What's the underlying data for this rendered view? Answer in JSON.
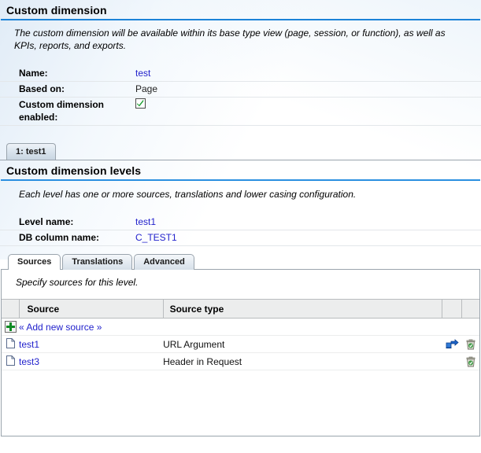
{
  "dimension_section": {
    "title": "Custom dimension",
    "description": "The custom dimension will be available within its base type view (page, session, or function), as well as KPIs, reports, and exports.",
    "fields": [
      {
        "label": "Name:",
        "value": "test",
        "type": "link"
      },
      {
        "label": "Based on:",
        "value": "Page",
        "type": "text"
      },
      {
        "label": "Custom dimension enabled:",
        "value": "",
        "type": "checkbox",
        "checked": true
      }
    ]
  },
  "level_tabs": {
    "items": [
      {
        "label": "1: test1",
        "active": true
      }
    ]
  },
  "levels_section": {
    "title": "Custom dimension levels",
    "description": "Each level has one or more sources, translations and lower casing configuration.",
    "fields": [
      {
        "label": "Level name:",
        "value": "test1",
        "type": "link"
      },
      {
        "label": "DB column name:",
        "value": "C_TEST1",
        "type": "link"
      }
    ]
  },
  "inner_tabs": {
    "items": [
      {
        "label": "Sources",
        "active": true
      },
      {
        "label": "Translations",
        "active": false
      },
      {
        "label": "Advanced",
        "active": false
      }
    ]
  },
  "sources_panel": {
    "note": "Specify sources for this level.",
    "table": {
      "columns": [
        "Source",
        "Source type",
        "",
        ""
      ],
      "add_row": {
        "label": "« Add new source »",
        "icon": "plus-icon"
      },
      "rows": [
        {
          "icon": "document-icon",
          "source": "test1",
          "source_type": "URL Argument",
          "actions": [
            "move-icon",
            "delete-icon"
          ]
        },
        {
          "icon": "document-icon",
          "source": "test3",
          "source_type": "Header in Request",
          "actions": [
            "delete-icon"
          ]
        }
      ]
    }
  },
  "colors": {
    "accent_rule": "#1c83d8",
    "link": "#2222cc",
    "check": "#1a9e2e",
    "plus": "#0f8a24",
    "header_bg": "#eceded",
    "border": "#9aa4ad"
  }
}
